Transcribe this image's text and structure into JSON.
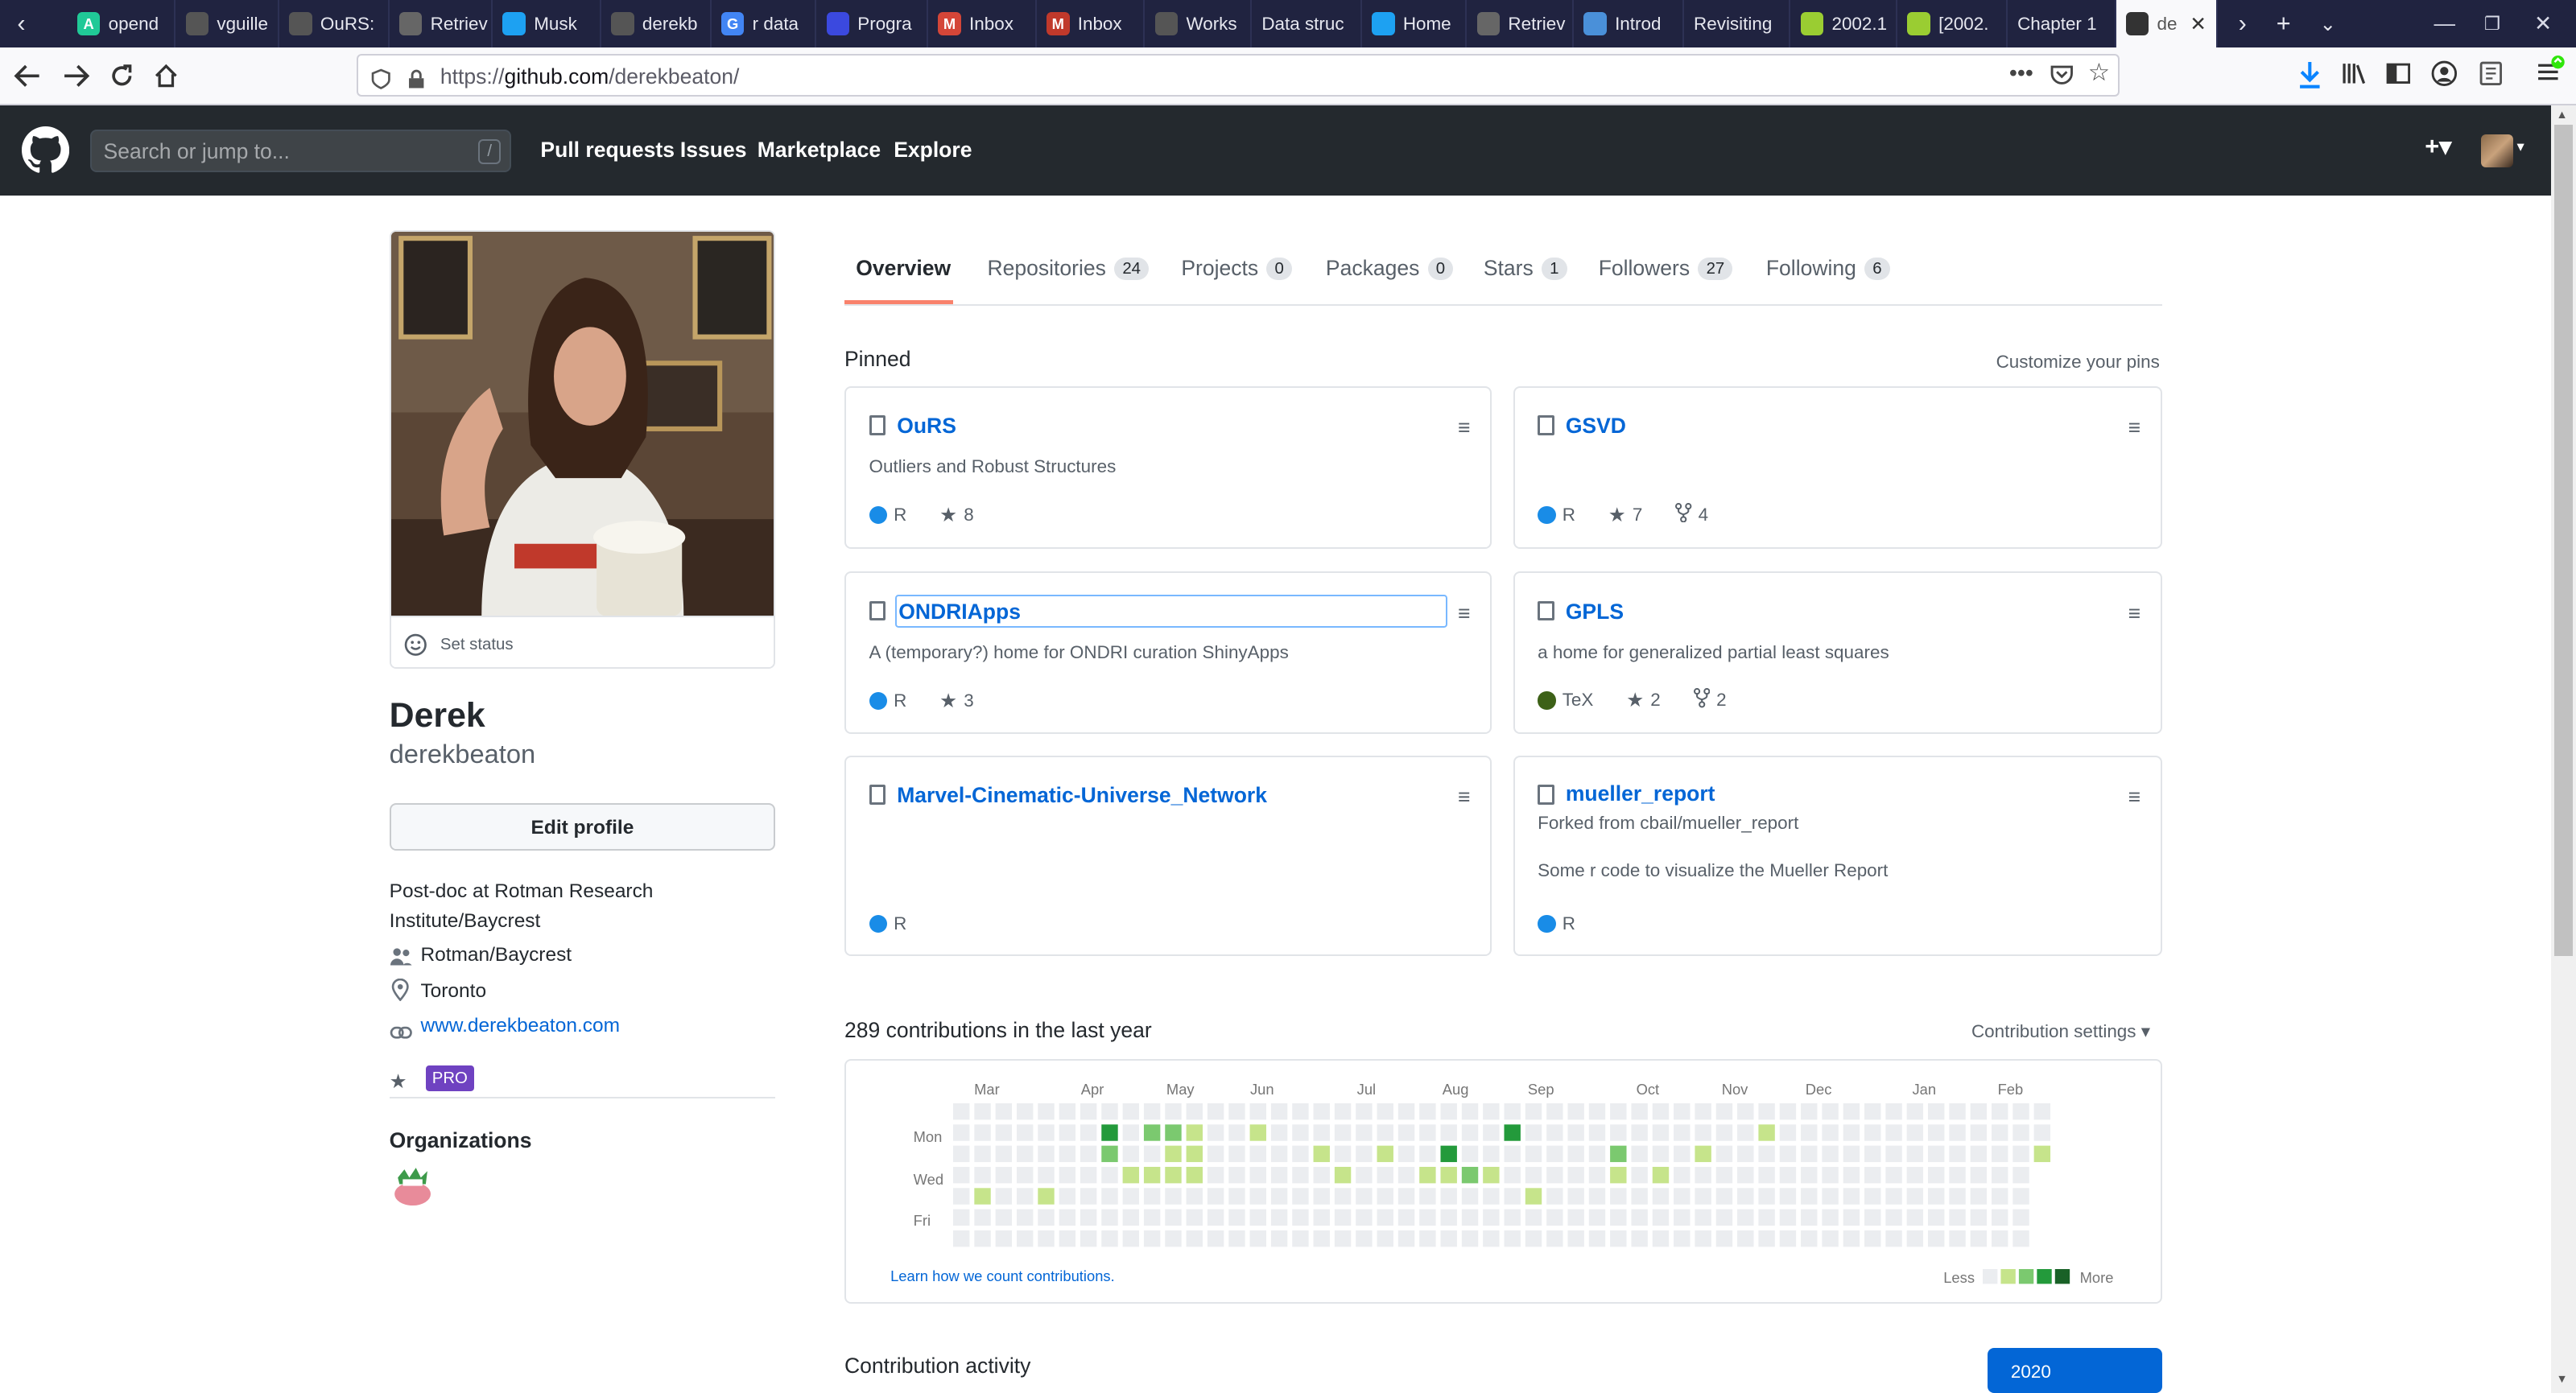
{
  "browser": {
    "tabs": [
      {
        "label": "opend",
        "color": "#20c997",
        "glyph": "A"
      },
      {
        "label": "vguille",
        "color": "#555",
        "glyph": ""
      },
      {
        "label": "OuRS:",
        "color": "#555",
        "glyph": ""
      },
      {
        "label": "Retriev",
        "color": "#666",
        "glyph": ""
      },
      {
        "label": "Musk",
        "color": "#1da1f2",
        "glyph": ""
      },
      {
        "label": "derekb",
        "color": "#555",
        "glyph": ""
      },
      {
        "label": "r data",
        "color": "#4285f4",
        "glyph": "G"
      },
      {
        "label": "Progra",
        "color": "#3b49df",
        "glyph": ""
      },
      {
        "label": "Inbox",
        "color": "#d44638",
        "glyph": "M"
      },
      {
        "label": "Inbox",
        "color": "#c0392b",
        "glyph": "M"
      },
      {
        "label": "Works",
        "color": "#555",
        "glyph": ""
      },
      {
        "label": "Data struc",
        "color": "",
        "glyph": ""
      },
      {
        "label": "Home",
        "color": "#1da1f2",
        "glyph": ""
      },
      {
        "label": "Retriev",
        "color": "#666",
        "glyph": ""
      },
      {
        "label": "Introd",
        "color": "#4a90d9",
        "glyph": ""
      },
      {
        "label": "Revisiting",
        "color": "",
        "glyph": ""
      },
      {
        "label": "2002.1",
        "color": "#9acd32",
        "glyph": ""
      },
      {
        "label": "[2002.",
        "color": "#9acd32",
        "glyph": ""
      },
      {
        "label": "Chapter 1",
        "color": "",
        "glyph": ""
      },
      {
        "label": "de",
        "color": "#333",
        "glyph": ""
      }
    ],
    "url_prefix": "https://",
    "url_host": "github.com",
    "url_path": "/derekbeaton/"
  },
  "header": {
    "search_placeholder": "Search or jump to...",
    "search_shortcut": "/",
    "nav": [
      "Pull requests",
      "Issues",
      "Marketplace",
      "Explore"
    ],
    "plus": "+▾"
  },
  "profile": {
    "set_status": "Set status",
    "name": "Derek",
    "username": "derekbeaton",
    "edit_button": "Edit profile",
    "bio_line1": "Post-doc at Rotman Research",
    "bio_line2": "Institute/Baycrest",
    "company": "Rotman/Baycrest",
    "location": "Toronto",
    "website": "www.derekbeaton.com",
    "pro_badge": "PRO",
    "organizations_heading": "Organizations"
  },
  "tabs": [
    {
      "label": "Overview",
      "count": ""
    },
    {
      "label": "Repositories",
      "count": "24"
    },
    {
      "label": "Projects",
      "count": "0"
    },
    {
      "label": "Packages",
      "count": "0"
    },
    {
      "label": "Stars",
      "count": "1"
    },
    {
      "label": "Followers",
      "count": "27"
    },
    {
      "label": "Following",
      "count": "6"
    }
  ],
  "pinned": {
    "heading": "Pinned",
    "customize": "Customize your pins",
    "repos": [
      {
        "name": "OuRS",
        "desc": "Outliers and Robust Structures",
        "forked_from": "",
        "lang": "R",
        "lang_color": "#198ce7",
        "stars": "8",
        "forks": ""
      },
      {
        "name": "GSVD",
        "desc": "",
        "forked_from": "",
        "lang": "R",
        "lang_color": "#198ce7",
        "stars": "7",
        "forks": "4"
      },
      {
        "name": "ONDRIApps",
        "desc": "A (temporary?) home for ONDRI curation ShinyApps",
        "forked_from": "",
        "lang": "R",
        "lang_color": "#198ce7",
        "stars": "3",
        "forks": ""
      },
      {
        "name": "GPLS",
        "desc": "a home for generalized partial least squares",
        "forked_from": "",
        "lang": "TeX",
        "lang_color": "#3d6117",
        "stars": "2",
        "forks": "2"
      },
      {
        "name": "Marvel-Cinematic-Universe_Network",
        "desc": "",
        "forked_from": "",
        "lang": "R",
        "lang_color": "#198ce7",
        "stars": "",
        "forks": ""
      },
      {
        "name": "mueller_report",
        "desc": "Some r code to visualize the Mueller Report",
        "forked_from": "Forked from cbail/mueller_report",
        "lang": "R",
        "lang_color": "#198ce7",
        "stars": "",
        "forks": ""
      }
    ]
  },
  "contributions": {
    "heading": "289 contributions in the last year",
    "settings": "Contribution settings ▾",
    "months": [
      "Mar",
      "Apr",
      "May",
      "Jun",
      "Jul",
      "Aug",
      "Sep",
      "Oct",
      "Nov",
      "Dec",
      "Jan",
      "Feb"
    ],
    "days": [
      "Mon",
      "Wed",
      "Fri"
    ],
    "learn_link": "Learn how we count contributions.",
    "less": "Less",
    "more": "More",
    "levels": [
      "#ebedf0",
      "#c6e48b",
      "#7bc96f",
      "#239a3b",
      "#196127"
    ],
    "grid": [
      "0000000000000000000000000000000000000000000000000000",
      "0000000302210010000000000030000000000010000000000000",
      "0000000200110000010010030000000200010000000000000001",
      "0000000011110000001000112100000101000000000000000000",
      "0100100000000000000000000001000000000000000000000000",
      "0000000000000000000000000000000000000000000000000000",
      "0000000000000000000000000000000000000000000000000000"
    ]
  },
  "activity": {
    "heading": "Contribution activity",
    "year": "2020"
  }
}
